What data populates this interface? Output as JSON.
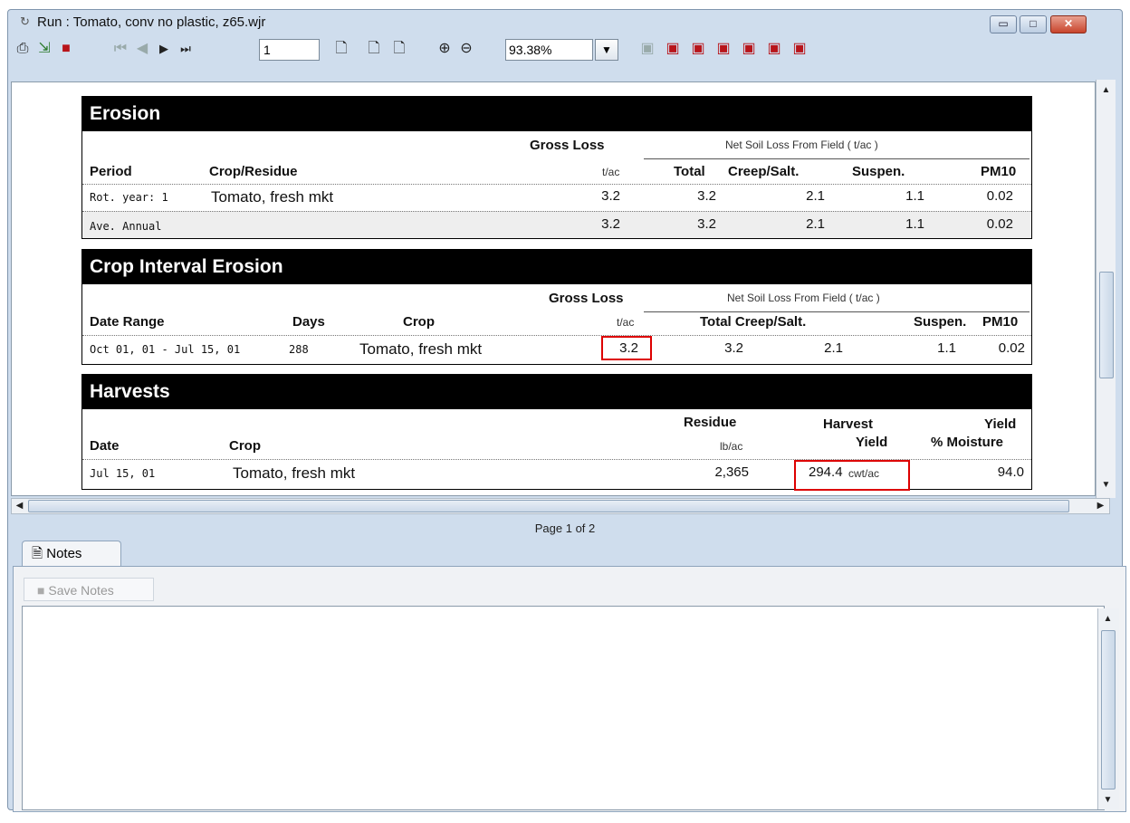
{
  "window": {
    "title": "Run : Tomato, conv no plastic, z65.wjr"
  },
  "toolbar": {
    "page_value": "1",
    "zoom_value": "93.38%"
  },
  "report": {
    "erosion": {
      "title": "Erosion",
      "gross_loss": "Gross Loss",
      "net_soil_loss": "Net Soil Loss From Field ( t/ac )",
      "cols": {
        "period": "Period",
        "crop_residue": "Crop/Residue",
        "unit": "t/ac",
        "total": "Total",
        "creep": "Creep/Salt.",
        "suspen": "Suspen.",
        "pm10": "PM10"
      },
      "rows": [
        {
          "period": "Rot. year: 1",
          "crop": "Tomato, fresh mkt",
          "gross": "3.2",
          "total": "3.2",
          "creep": "2.1",
          "suspen": "1.1",
          "pm10": "0.02"
        },
        {
          "period": "Ave. Annual",
          "crop": "",
          "gross": "3.2",
          "total": "3.2",
          "creep": "2.1",
          "suspen": "1.1",
          "pm10": "0.02"
        }
      ]
    },
    "crop_interval": {
      "title": "Crop Interval Erosion",
      "gross_loss": "Gross Loss",
      "net_soil_loss": "Net Soil Loss From Field ( t/ac )",
      "cols": {
        "date_range": "Date Range",
        "days": "Days",
        "crop": "Crop",
        "unit": "t/ac",
        "total_creep": "Total Creep/Salt.",
        "suspen": "Suspen.",
        "pm10": "PM10"
      },
      "row": {
        "date_range": "Oct 01, 01 - Jul 15, 01",
        "days": "288",
        "crop": "Tomato, fresh mkt",
        "gross": "3.2",
        "total": "3.2",
        "creep": "2.1",
        "suspen": "1.1",
        "pm10": "0.02"
      }
    },
    "harvests": {
      "title": "Harvests",
      "cols": {
        "date": "Date",
        "crop": "Crop",
        "residue": "Residue",
        "residue_unit": "lb/ac",
        "harvest": "Harvest",
        "yield": "Yield",
        "yield2": "Yield",
        "moisture": "% Moisture"
      },
      "row": {
        "date": "Jul 15, 01",
        "crop": "Tomato, fresh mkt",
        "residue": "2,365",
        "harvest_yield": "294.4",
        "harvest_unit": "cwt/ac",
        "moisture": "94.0"
      }
    }
  },
  "footer": {
    "page_text": "Page 1 of 2"
  },
  "notes": {
    "tab_label": "Notes",
    "save_label": "Save Notes"
  }
}
